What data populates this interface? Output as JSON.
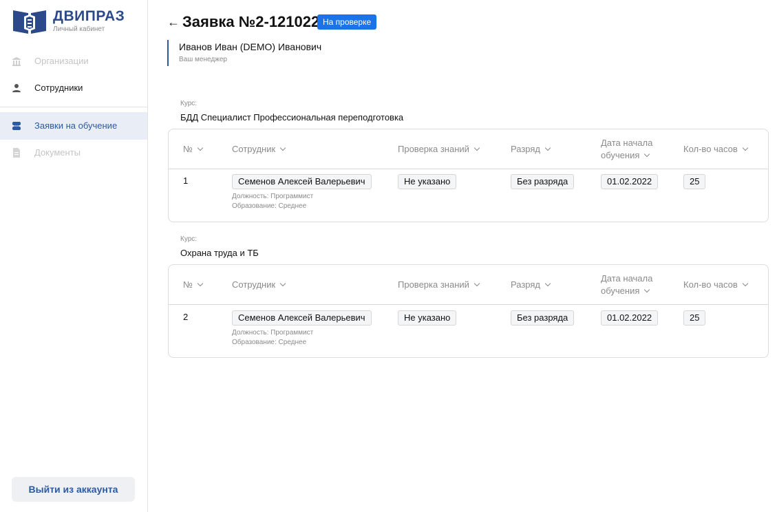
{
  "brand": {
    "name": "ДВИПРАЗ",
    "subtitle": "Личный кабинет",
    "color": "#2c4a8a"
  },
  "sidebar": {
    "items": [
      {
        "label": "Организации",
        "icon": "building-icon",
        "state": "disabled"
      },
      {
        "label": "Сотрудники",
        "icon": "person-icon",
        "state": "normal"
      },
      {
        "label": "Заявки на обучение",
        "icon": "stack-icon",
        "state": "active"
      },
      {
        "label": "Документы",
        "icon": "document-icon",
        "state": "disabled"
      }
    ],
    "logout_label": "Выйти из аккаунта"
  },
  "header": {
    "back_icon": "arrow-left-icon",
    "title": "Заявка №2-121022",
    "status": "На проверке",
    "status_color": "#1a73e8"
  },
  "manager": {
    "name": "Иванов Иван (DEMO) Иванович",
    "role": "Ваш менеджер"
  },
  "table_headers": {
    "num": "№",
    "employee": "Сотрудник",
    "knowledge_check": "Проверка знаний",
    "rank": "Разряд",
    "start_date_line1": "Дата начала",
    "start_date_line2": "обучения",
    "hours": "Кол-во часов"
  },
  "courses": [
    {
      "caption": "Курс:",
      "name": "БДД Специалист Профессиональная переподготовка",
      "rows": [
        {
          "num": "1",
          "employee": "Семенов Алексей Валерьевич",
          "position": "Должность: Программист",
          "education": "Образование: Среднее",
          "knowledge_check": "Не указано",
          "rank": "Без разряда",
          "start_date": "01.02.2022",
          "hours": "25"
        }
      ]
    },
    {
      "caption": "Курс:",
      "name": "Охрана труда и ТБ",
      "rows": [
        {
          "num": "2",
          "employee": "Семенов Алексей Валерьевич",
          "position": "Должность: Программист",
          "education": "Образование: Среднее",
          "knowledge_check": "Не указано",
          "rank": "Без разряда",
          "start_date": "01.02.2022",
          "hours": "25"
        }
      ]
    }
  ]
}
